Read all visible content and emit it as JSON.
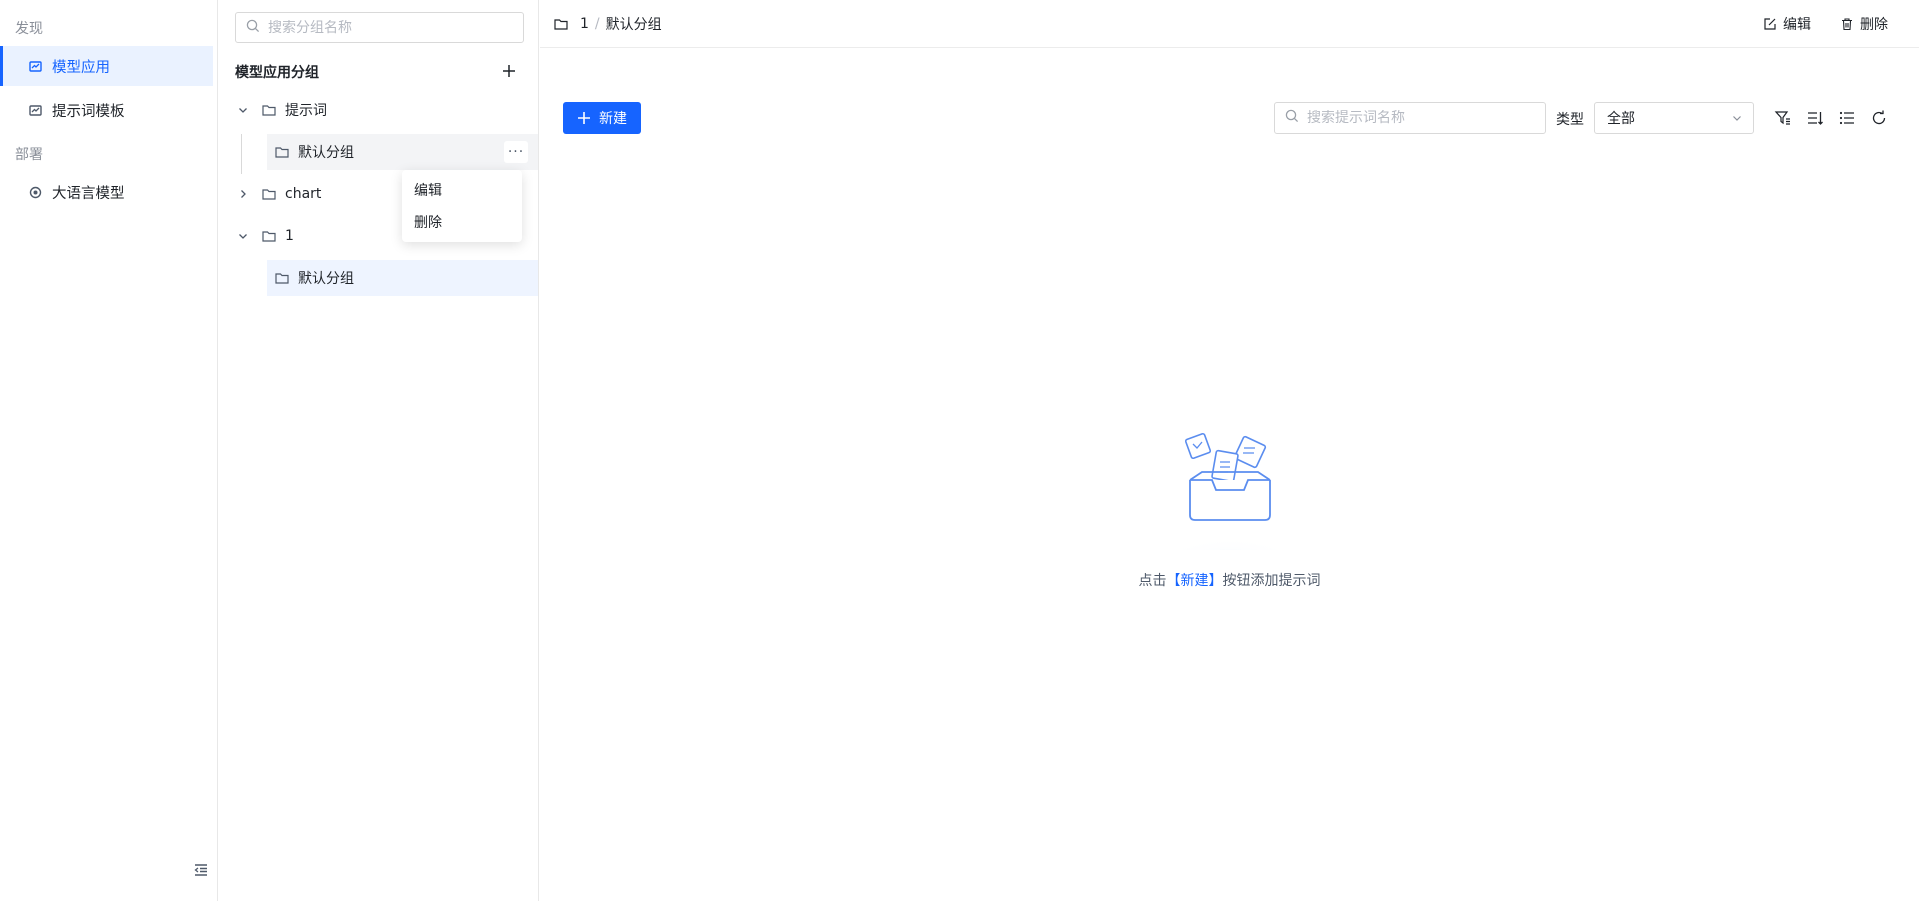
{
  "nav": {
    "sections": [
      {
        "title": "发现",
        "items": [
          {
            "label": "模型应用",
            "active": true
          },
          {
            "label": "提示词模板",
            "active": false
          }
        ]
      },
      {
        "title": "部署",
        "items": [
          {
            "label": "大语言模型",
            "active": false
          }
        ]
      }
    ]
  },
  "groups": {
    "search_placeholder": "搜索分组名称",
    "title": "模型应用分组",
    "tree": [
      {
        "label": "提示词",
        "expanded": true,
        "children": [
          {
            "label": "默认分组"
          }
        ]
      },
      {
        "label": "chart",
        "expanded": false
      },
      {
        "label": "1",
        "expanded": true,
        "children": [
          {
            "label": "默认分组"
          }
        ]
      }
    ],
    "more_label": "···",
    "context_menu": [
      "编辑",
      "删除"
    ]
  },
  "main": {
    "breadcrumb": [
      "1",
      "默认分组"
    ],
    "breadcrumb_sep": "/",
    "edit_label": "编辑",
    "delete_label": "删除",
    "new_label": "新建",
    "search_placeholder": "搜索提示词名称",
    "type_label": "类型",
    "type_value": "全部",
    "empty": {
      "prefix": "点击",
      "link": "【新建】",
      "suffix": "按钮添加提示词"
    }
  },
  "colors": {
    "primary": "#1664ff",
    "selected_bg": "#eef4ff"
  }
}
